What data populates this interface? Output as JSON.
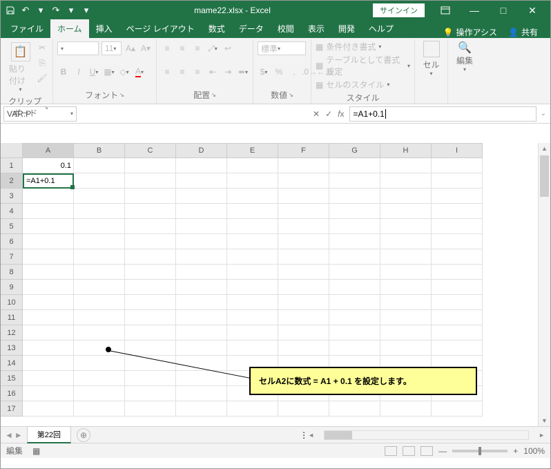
{
  "title": {
    "filename": "mame22.xlsx",
    "app": "Excel",
    "signin": "サインイン"
  },
  "tabs": {
    "file": "ファイル",
    "home": "ホーム",
    "insert": "挿入",
    "layout": "ページ レイアウト",
    "formulas": "数式",
    "data": "データ",
    "review": "校閲",
    "view": "表示",
    "dev": "開発",
    "help": "ヘルプ",
    "tellme": "操作アシス",
    "share": "共有"
  },
  "ribbon": {
    "paste": "貼り付け",
    "clipboard": "クリップボード",
    "font": "フォント",
    "fontsize": "11",
    "align": "配置",
    "wrap": "標準",
    "number": "数値",
    "cond": "条件付き書式",
    "table": "テーブルとして書式設定",
    "cellstyle": "セルのスタイル",
    "style": "スタイル",
    "cell": "セル",
    "edit": "編集"
  },
  "formula_bar": {
    "name": "VAR.P",
    "formula": "=A1+0.1"
  },
  "cols": [
    "A",
    "B",
    "C",
    "D",
    "E",
    "F",
    "G",
    "H",
    "I"
  ],
  "rows": [
    "1",
    "2",
    "3",
    "4",
    "5",
    "6",
    "7",
    "8",
    "9",
    "10",
    "11",
    "12",
    "13",
    "14",
    "15",
    "16",
    "17"
  ],
  "cells": {
    "A1": "0.1",
    "A2": "=A1+0.1"
  },
  "callout": "セルA2に数式 = A1 + 0.1 を設定します。",
  "sheet": {
    "name": "第22回"
  },
  "status": {
    "mode": "編集",
    "zoom": "100%"
  }
}
